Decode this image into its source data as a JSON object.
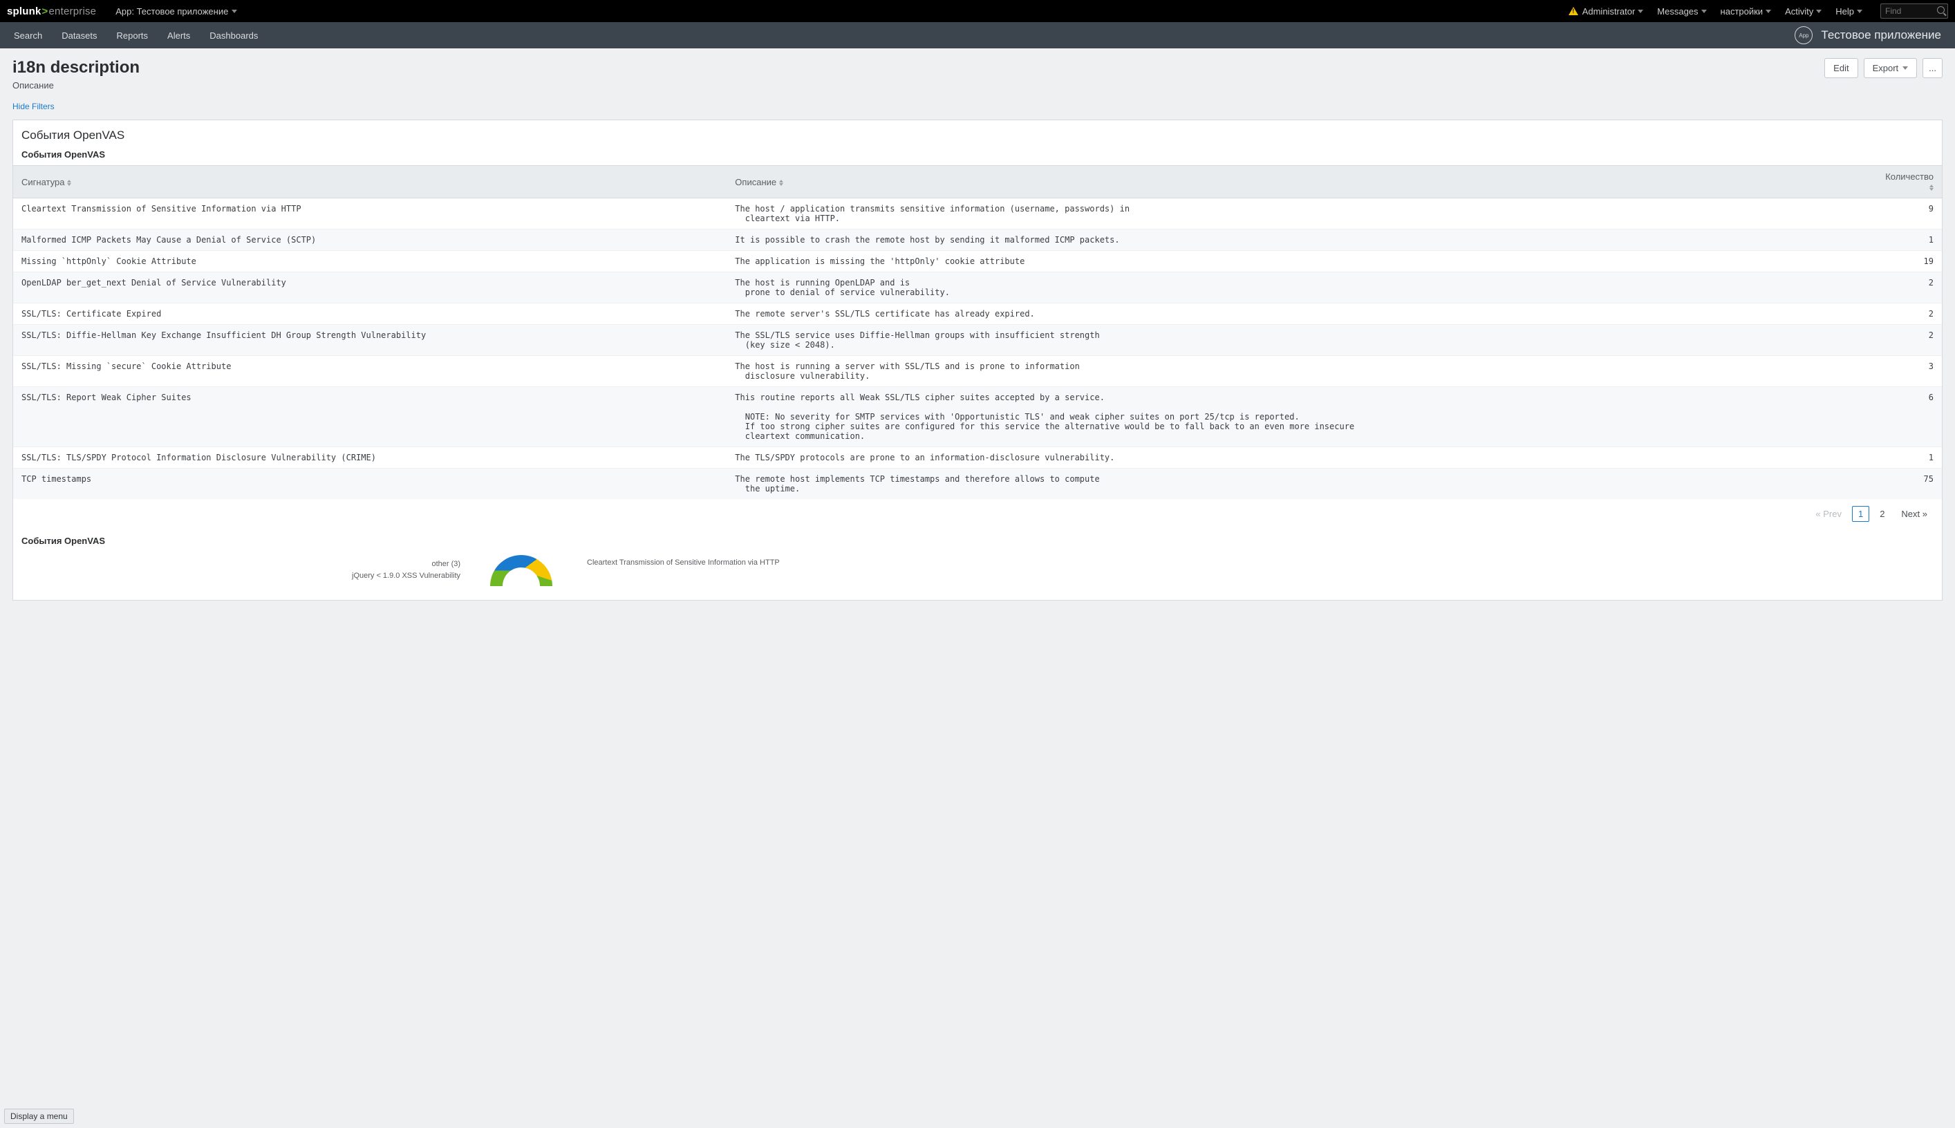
{
  "topbar": {
    "brand_a": "splunk",
    "brand_b": "enterprise",
    "app_label": "App: Тестовое приложение",
    "admin": "Administrator",
    "messages": "Messages",
    "settings": "настройки",
    "activity": "Activity",
    "help": "Help",
    "find_placeholder": "Find"
  },
  "subbar": {
    "nav": [
      "Search",
      "Datasets",
      "Reports",
      "Alerts",
      "Dashboards"
    ],
    "app_badge": "App",
    "app_name": "Тестовое приложение"
  },
  "page": {
    "title": "i18n description",
    "desc": "Описание",
    "edit": "Edit",
    "export": "Export",
    "more": "..."
  },
  "filters_link": "Hide Filters",
  "panel1": {
    "title": "События OpenVAS",
    "subtitle": "События OpenVAS",
    "cols": [
      "Сигнатура",
      "Описание",
      "Количество"
    ],
    "rows": [
      {
        "sig": "Cleartext Transmission of Sensitive Information via HTTP",
        "desc": "The host / application transmits sensitive information (username, passwords) in\n  cleartext via HTTP.",
        "cnt": "9"
      },
      {
        "sig": "Malformed ICMP Packets May Cause a Denial of Service (SCTP)",
        "desc": "It is possible to crash the remote host by sending it malformed ICMP packets.",
        "cnt": "1"
      },
      {
        "sig": "Missing `httpOnly` Cookie Attribute",
        "desc": "The application is missing the 'httpOnly' cookie attribute",
        "cnt": "19"
      },
      {
        "sig": "OpenLDAP ber_get_next Denial of Service Vulnerability",
        "desc": "The host is running OpenLDAP and is\n  prone to denial of service vulnerability.",
        "cnt": "2"
      },
      {
        "sig": "SSL/TLS: Certificate Expired",
        "desc": "The remote server's SSL/TLS certificate has already expired.",
        "cnt": "2"
      },
      {
        "sig": "SSL/TLS: Diffie-Hellman Key Exchange Insufficient DH Group Strength Vulnerability",
        "desc": "The SSL/TLS service uses Diffie-Hellman groups with insufficient strength\n  (key size < 2048).",
        "cnt": "2"
      },
      {
        "sig": "SSL/TLS: Missing `secure` Cookie Attribute",
        "desc": "The host is running a server with SSL/TLS and is prone to information\n  disclosure vulnerability.",
        "cnt": "3"
      },
      {
        "sig": "SSL/TLS: Report Weak Cipher Suites",
        "desc": "This routine reports all Weak SSL/TLS cipher suites accepted by a service.\n\n  NOTE: No severity for SMTP services with 'Opportunistic TLS' and weak cipher suites on port 25/tcp is reported.\n  If too strong cipher suites are configured for this service the alternative would be to fall back to an even more insecure\n  cleartext communication.",
        "cnt": "6"
      },
      {
        "sig": "SSL/TLS: TLS/SPDY Protocol Information Disclosure Vulnerability (CRIME)",
        "desc": "The TLS/SPDY protocols are prone to an information-disclosure vulnerability.",
        "cnt": "1"
      },
      {
        "sig": "TCP timestamps",
        "desc": "The remote host implements TCP timestamps and therefore allows to compute\n  the uptime.",
        "cnt": "75"
      }
    ],
    "pager": {
      "prev": "« Prev",
      "p1": "1",
      "p2": "2",
      "next": "Next »"
    }
  },
  "panel2": {
    "subtitle": "События OpenVAS",
    "legend_left_1": "other (3)",
    "legend_left_2": "jQuery < 1.9.0 XSS Vulnerability",
    "legend_right_1": "Cleartext Transmission of Sensitive Information via HTTP"
  },
  "tooltip": "Display a menu",
  "chart_data": {
    "type": "pie",
    "title": "События OpenVAS",
    "series": [
      {
        "name": "Cleartext Transmission of Sensitive Information via HTTP",
        "value": 9
      },
      {
        "name": "other (3)",
        "value": 3
      },
      {
        "name": "jQuery < 1.9.0 XSS Vulnerability",
        "value": 3
      }
    ]
  }
}
